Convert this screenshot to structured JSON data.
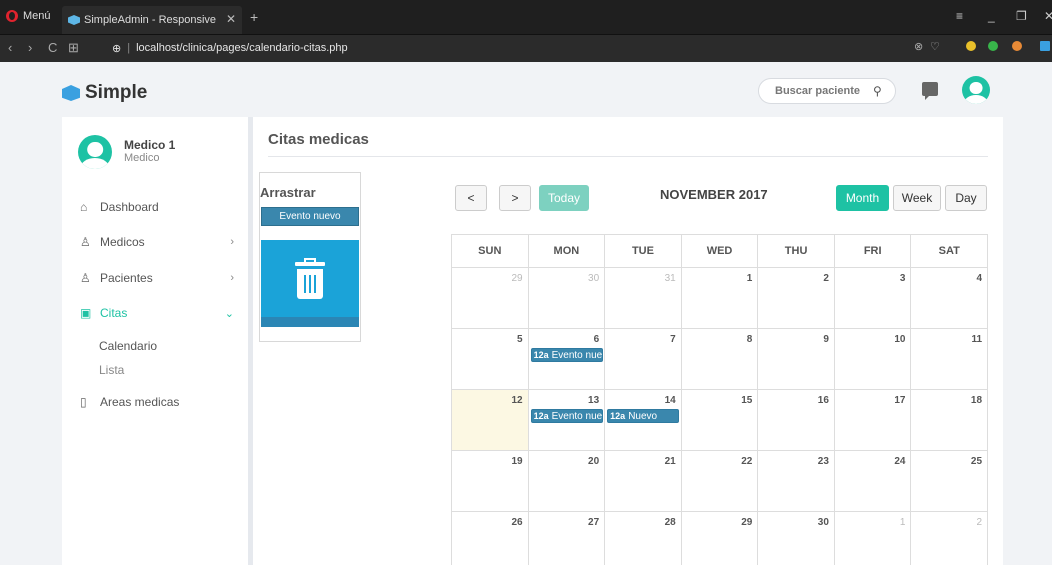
{
  "browser": {
    "menu_label": "Menú",
    "tab_title": "SimpleAdmin - Responsive",
    "tab_close": "✕",
    "new_tab": "+",
    "url": "localhost/clinica/pages/calendario-citas.php"
  },
  "header": {
    "logo_text": "Simple",
    "search_placeholder": "Buscar paciente"
  },
  "profile": {
    "name": "Medico 1",
    "role": "Medico"
  },
  "sidebar": {
    "items": [
      {
        "label": "Dashboard",
        "icon": "dashboard-icon"
      },
      {
        "label": "Medicos",
        "icon": "user-icon"
      },
      {
        "label": "Pacientes",
        "icon": "user-icon"
      },
      {
        "label": "Citas",
        "icon": "calendar-icon"
      },
      {
        "label": "Areas medicas",
        "icon": "hospital-icon"
      }
    ],
    "sub_items": [
      "Calendario",
      "Lista"
    ]
  },
  "main": {
    "title": "Citas medicas",
    "drag_title": "Arrastrar",
    "drag_event": "Evento nuevo"
  },
  "calendar": {
    "title": "NOVEMBER 2017",
    "prev": "<",
    "next": ">",
    "today": "Today",
    "views": [
      "Month",
      "Week",
      "Day"
    ],
    "active_view": "Month",
    "days": [
      "SUN",
      "MON",
      "TUE",
      "WED",
      "THU",
      "FRI",
      "SAT"
    ],
    "weeks": [
      [
        {
          "n": "29",
          "o": true
        },
        {
          "n": "30",
          "o": true
        },
        {
          "n": "31",
          "o": true
        },
        {
          "n": "1"
        },
        {
          "n": "2"
        },
        {
          "n": "3"
        },
        {
          "n": "4"
        }
      ],
      [
        {
          "n": "5"
        },
        {
          "n": "6",
          "ev": "Evento nuevo",
          "t": "12a"
        },
        {
          "n": "7"
        },
        {
          "n": "8"
        },
        {
          "n": "9"
        },
        {
          "n": "10"
        },
        {
          "n": "11"
        }
      ],
      [
        {
          "n": "12",
          "today": true
        },
        {
          "n": "13",
          "ev": "Evento nuevo",
          "t": "12a"
        },
        {
          "n": "14",
          "ev": "Nuevo",
          "t": "12a"
        },
        {
          "n": "15"
        },
        {
          "n": "16"
        },
        {
          "n": "17"
        },
        {
          "n": "18"
        }
      ],
      [
        {
          "n": "19"
        },
        {
          "n": "20"
        },
        {
          "n": "21"
        },
        {
          "n": "22"
        },
        {
          "n": "23"
        },
        {
          "n": "24"
        },
        {
          "n": "25"
        }
      ],
      [
        {
          "n": "26"
        },
        {
          "n": "27"
        },
        {
          "n": "28"
        },
        {
          "n": "29"
        },
        {
          "n": "30"
        },
        {
          "n": "1",
          "o": true
        },
        {
          "n": "2",
          "o": true
        }
      ]
    ]
  },
  "colors": {
    "accent": "#1ec2a4",
    "event": "#3a87ad",
    "trash": "#1ba3d8"
  }
}
